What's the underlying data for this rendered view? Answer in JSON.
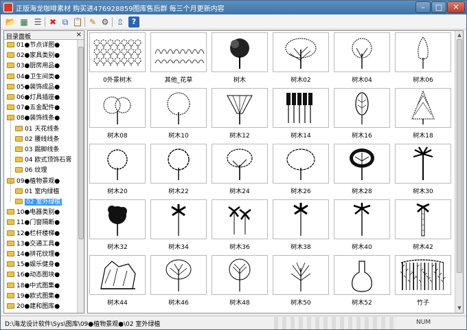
{
  "window": {
    "title": "正版海龙咖啡素材 购买进476928859图库售后群 每三个月更新内容"
  },
  "toolbar": {
    "icons": [
      "open-folder-icon",
      "view-icon",
      "list-icon",
      "delete-icon",
      "copy-icon",
      "paste-icon",
      "edit-icon",
      "settings-icon",
      "export-icon",
      "help-icon"
    ]
  },
  "panel": {
    "title": "目录面板",
    "close": "×"
  },
  "tree": {
    "items": [
      {
        "label": "01●节点详图●"
      },
      {
        "label": "02●家具类别●"
      },
      {
        "label": "03●厨房用品●"
      },
      {
        "label": "04●卫生间类●"
      },
      {
        "label": "05●装饰成品●"
      },
      {
        "label": "06●灯具插座●"
      },
      {
        "label": "07●五金配件●"
      },
      {
        "label": "08●装饰线条●"
      },
      {
        "label": "01 天花线条"
      },
      {
        "label": "02 腰线线条"
      },
      {
        "label": "03 踢脚线条"
      },
      {
        "label": "04 欧式顶饰石膏"
      },
      {
        "label": "06 纹理"
      },
      {
        "label": "09●植物景观●"
      },
      {
        "label": "01 室内绿植"
      },
      {
        "label": "02 室外绿植"
      },
      {
        "label": "10●电器类别●"
      },
      {
        "label": "11●门窗隔断●"
      },
      {
        "label": "12●栏杆楼梯●"
      },
      {
        "label": "13●交通工具●"
      },
      {
        "label": "14●拼花纹理●"
      },
      {
        "label": "15●娱乐健身●"
      },
      {
        "label": "16●动态图块●"
      },
      {
        "label": "18●中式图集●"
      },
      {
        "label": "19●欧式图集●"
      },
      {
        "label": "20●建和图库●"
      }
    ]
  },
  "tiles": [
    {
      "label": "0外景树木"
    },
    {
      "label": "其他_花草"
    },
    {
      "label": "树木"
    },
    {
      "label": "树木02"
    },
    {
      "label": "树木04"
    },
    {
      "label": "树木06"
    },
    {
      "label": "树木08"
    },
    {
      "label": "树木10"
    },
    {
      "label": "树木12"
    },
    {
      "label": "树木14"
    },
    {
      "label": "树木16"
    },
    {
      "label": "树木18"
    },
    {
      "label": "树木20"
    },
    {
      "label": "树木22"
    },
    {
      "label": "树木24"
    },
    {
      "label": "树木26"
    },
    {
      "label": "树木28"
    },
    {
      "label": "树木30"
    },
    {
      "label": "树木32"
    },
    {
      "label": "树木34"
    },
    {
      "label": "树木36"
    },
    {
      "label": "树木38"
    },
    {
      "label": "树木40"
    },
    {
      "label": "树木42"
    },
    {
      "label": "树木44"
    },
    {
      "label": "树木46"
    },
    {
      "label": "树木48"
    },
    {
      "label": "树木50"
    },
    {
      "label": "树木52"
    },
    {
      "label": "竹子"
    }
  ],
  "status": {
    "path": "D:\\海龙设计软件\\Sys\\图库\\09●植物景观●\\02 室外绿植",
    "num": "NUM"
  }
}
